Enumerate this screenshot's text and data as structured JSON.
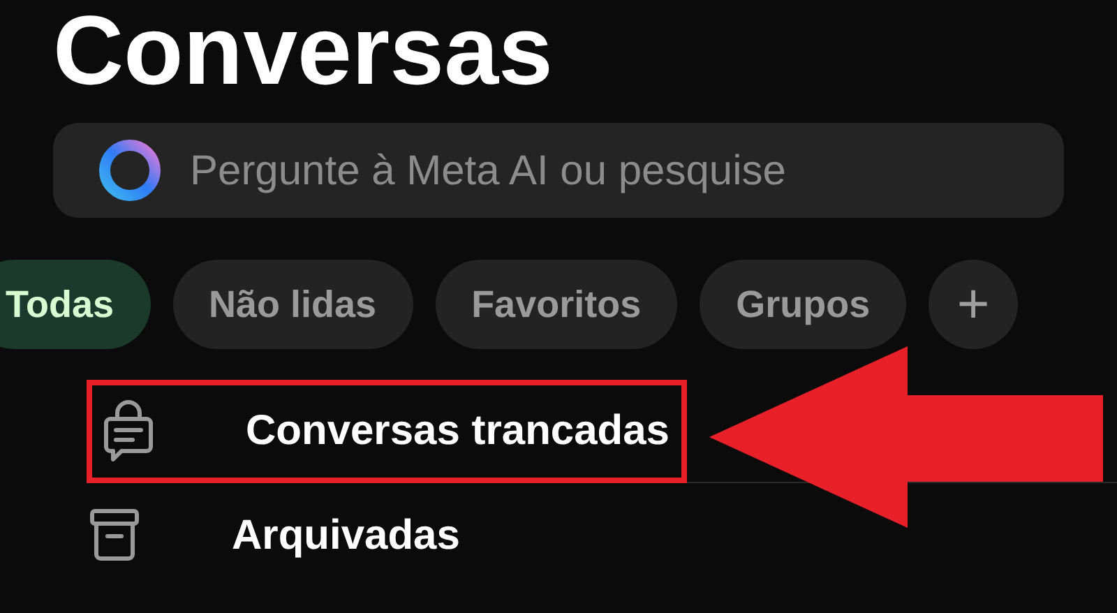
{
  "title": "Conversas",
  "search": {
    "placeholder": "Pergunte à Meta AI ou pesquise"
  },
  "filters": [
    {
      "label": "Todas",
      "selected": true
    },
    {
      "label": "Não lidas",
      "selected": false
    },
    {
      "label": "Favoritos",
      "selected": false
    },
    {
      "label": "Grupos",
      "selected": false
    }
  ],
  "add_filter": "+",
  "items": [
    {
      "kind": "locked",
      "label": "Conversas trancadas",
      "highlighted": true
    },
    {
      "kind": "archive",
      "label": "Arquivadas",
      "highlighted": false
    }
  ]
}
